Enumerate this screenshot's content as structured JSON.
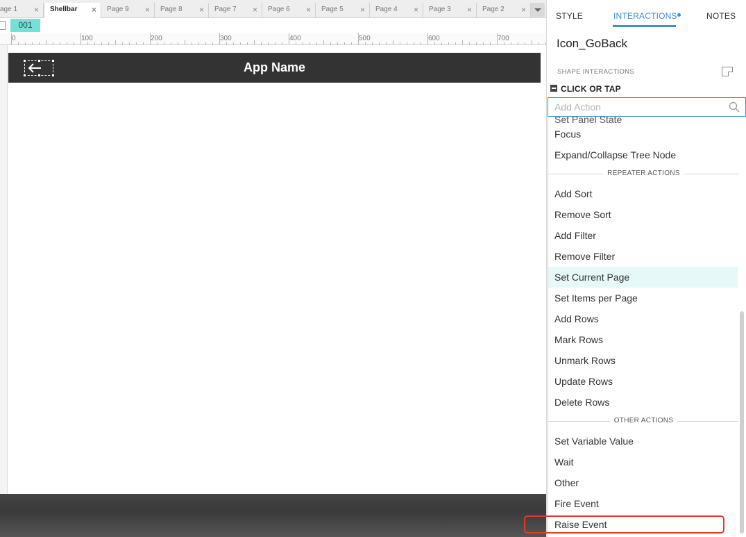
{
  "tabs": [
    {
      "label": "age 1",
      "active": false
    },
    {
      "label": "Shellbar",
      "active": true
    },
    {
      "label": "Page 9",
      "active": false
    },
    {
      "label": "Page 8",
      "active": false
    },
    {
      "label": "Page 7",
      "active": false
    },
    {
      "label": "Page 6",
      "active": false
    },
    {
      "label": "Page 5",
      "active": false
    },
    {
      "label": "Page 4",
      "active": false
    },
    {
      "label": "Page 3",
      "active": false
    },
    {
      "label": "Page 2",
      "active": false
    }
  ],
  "tab_close_glyph": "×",
  "page_id": "001",
  "ruler_labels": [
    "0",
    "100",
    "200",
    "300",
    "400",
    "500",
    "600",
    "700"
  ],
  "canvas": {
    "shellbar_title": "App Name",
    "shellbar_color": "#333333"
  },
  "panel": {
    "tabs": {
      "style": "STYLE",
      "interactions": "INTERACTIONS",
      "notes": "NOTES"
    },
    "widget_name": "Icon_GoBack",
    "shape_interactions_label": "SHAPE INTERACTIONS",
    "event_label": "CLICK OR TAP",
    "add_action_placeholder": "Add Action",
    "accent_color": "#3c8fd6",
    "partial_top_item": "Set Panel State",
    "options_group1": [
      "Focus",
      "Expand/Collapse Tree Node"
    ],
    "section_repeater": "REPEATER ACTIONS",
    "options_repeater": [
      "Add Sort",
      "Remove Sort",
      "Add Filter",
      "Remove Filter",
      "Set Current Page",
      "Set Items per Page",
      "Add Rows",
      "Mark Rows",
      "Unmark Rows",
      "Update Rows",
      "Delete Rows"
    ],
    "highlighted_option": "Set Current Page",
    "section_other": "OTHER ACTIONS",
    "options_other": [
      "Set Variable Value",
      "Wait",
      "Other",
      "Fire Event",
      "Raise Event"
    ],
    "annotated_option": "Raise Event",
    "annotation_color": "#e23a2a"
  }
}
